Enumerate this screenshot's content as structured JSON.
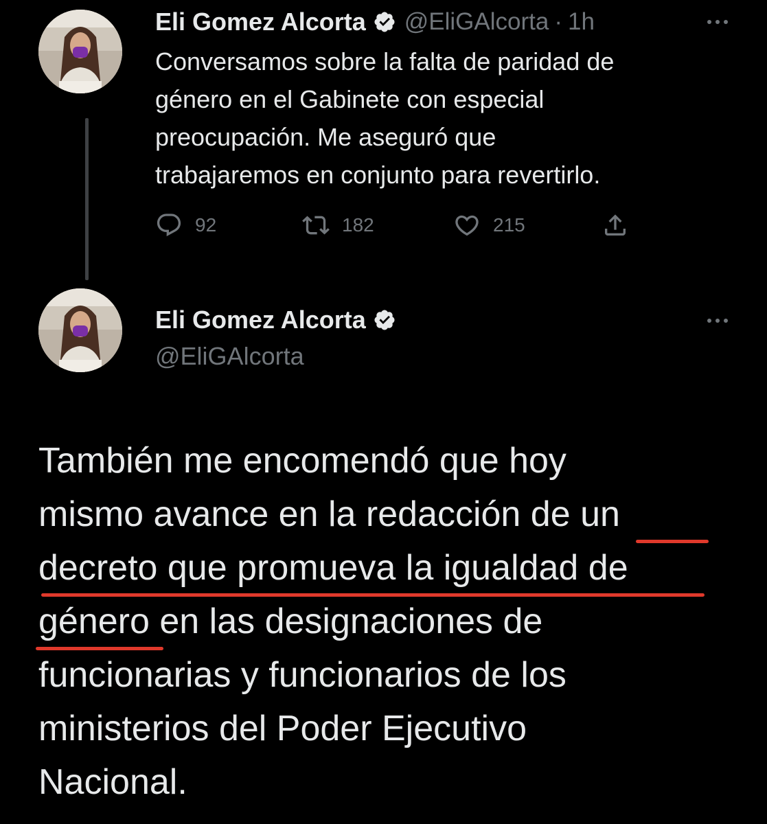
{
  "tweet1": {
    "author_name": "Eli Gomez Alcorta",
    "handle": "@EliGAlcorta",
    "separator": "·",
    "time": "1h",
    "verified_icon": "verified-badge-icon",
    "text": "Conversamos sobre la falta de paridad de género en el Gabinete con especial preocupación. Me aseguró que trabajaremos en conjunto para revertirlo.",
    "text_lines": [
      "Conversamos sobre la falta de paridad de",
      "género en el Gabinete con especial",
      "preocupación. Me aseguró que",
      "trabajaremos en conjunto para revertirlo."
    ],
    "actions": {
      "replies": "92",
      "retweets": "182",
      "likes": "215",
      "reply_icon": "reply-icon",
      "retweet_icon": "retweet-icon",
      "like_icon": "heart-icon",
      "share_icon": "share-icon"
    },
    "more_icon": "more-options-icon"
  },
  "tweet2": {
    "author_name": "Eli Gomez Alcorta",
    "handle": "@EliGAlcorta",
    "verified_icon": "verified-badge-icon",
    "more_icon": "more-options-icon",
    "text": "También me encomendó que hoy mismo avance en la redacción de un decreto que promueva la igualdad de género en las designaciones de funcionarias y funcionarios de los ministerios del Poder Ejecutivo Nacional.",
    "text_lines": [
      "También me encomendó que hoy",
      "mismo avance en la redacción de un",
      "decreto que promueva la igualdad de",
      "género en las designaciones de",
      "funcionarias y funcionarios de los",
      "ministerios del Poder Ejecutivo",
      "Nacional."
    ]
  },
  "colors": {
    "background": "#000000",
    "primary_text": "#e7e9ea",
    "secondary_text": "#71767b",
    "verified_badge": "#e7e9ea",
    "annotation_underline": "#e0392b",
    "thread_line": "#3e4144"
  }
}
